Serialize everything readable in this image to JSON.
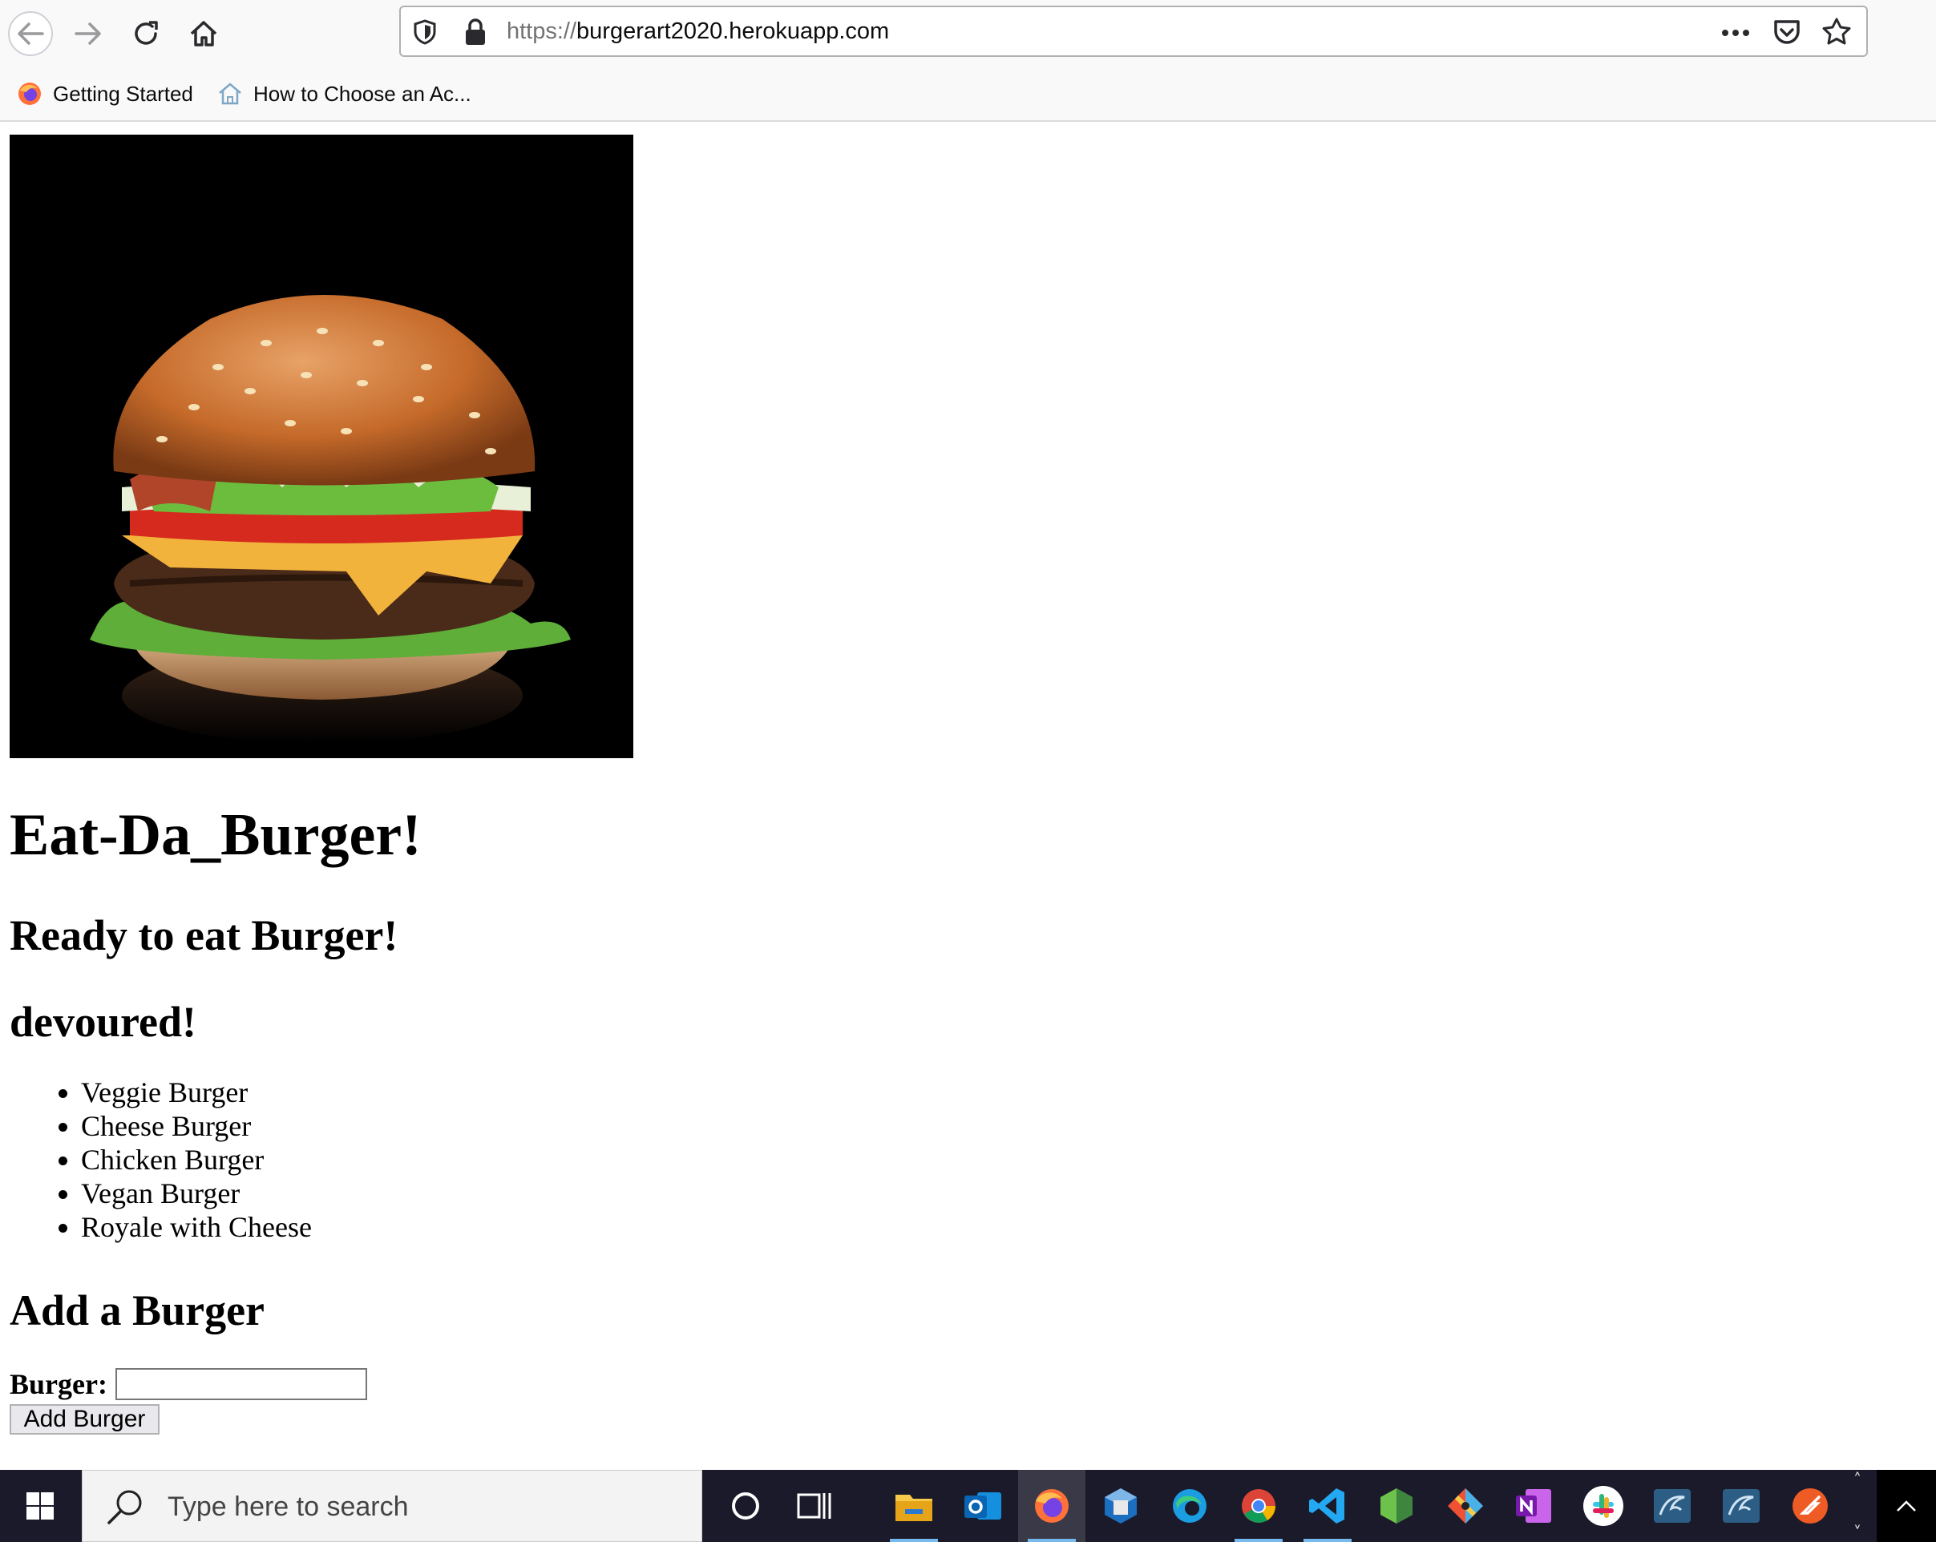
{
  "browser": {
    "url_scheme": "https://",
    "url_host": "burgerart2020.herokuapp.com",
    "bookmarks": [
      {
        "label": "Getting Started",
        "icon": "firefox-icon"
      },
      {
        "label": "How to Choose an Ac...",
        "icon": "house-icon"
      }
    ]
  },
  "page": {
    "hero_image": "burger-photo",
    "title": "Eat-Da_Burger!",
    "ready_heading": "Ready to eat Burger!",
    "devoured_heading": "devoured!",
    "devoured_list": [
      "Veggie Burger",
      "Cheese Burger",
      "Chicken Burger",
      "Vegan Burger",
      "Royale with Cheese"
    ],
    "add_heading": "Add a Burger",
    "form": {
      "label": "Burger:",
      "input_value": "",
      "button_label": "Add Burger"
    }
  },
  "taskbar": {
    "search_placeholder": "Type here to search",
    "apps": [
      "cortana-icon",
      "task-view-icon",
      "file-explorer-icon",
      "outlook-icon",
      "firefox-icon",
      "virtualbox-icon",
      "edge-icon",
      "chrome-icon",
      "vscode-icon",
      "nodejs-icon",
      "git-icon",
      "onenote-icon",
      "slack-icon",
      "mysql-workbench-icon",
      "mysql-workbench-icon",
      "postman-icon"
    ],
    "active_app": "firefox-icon"
  }
}
